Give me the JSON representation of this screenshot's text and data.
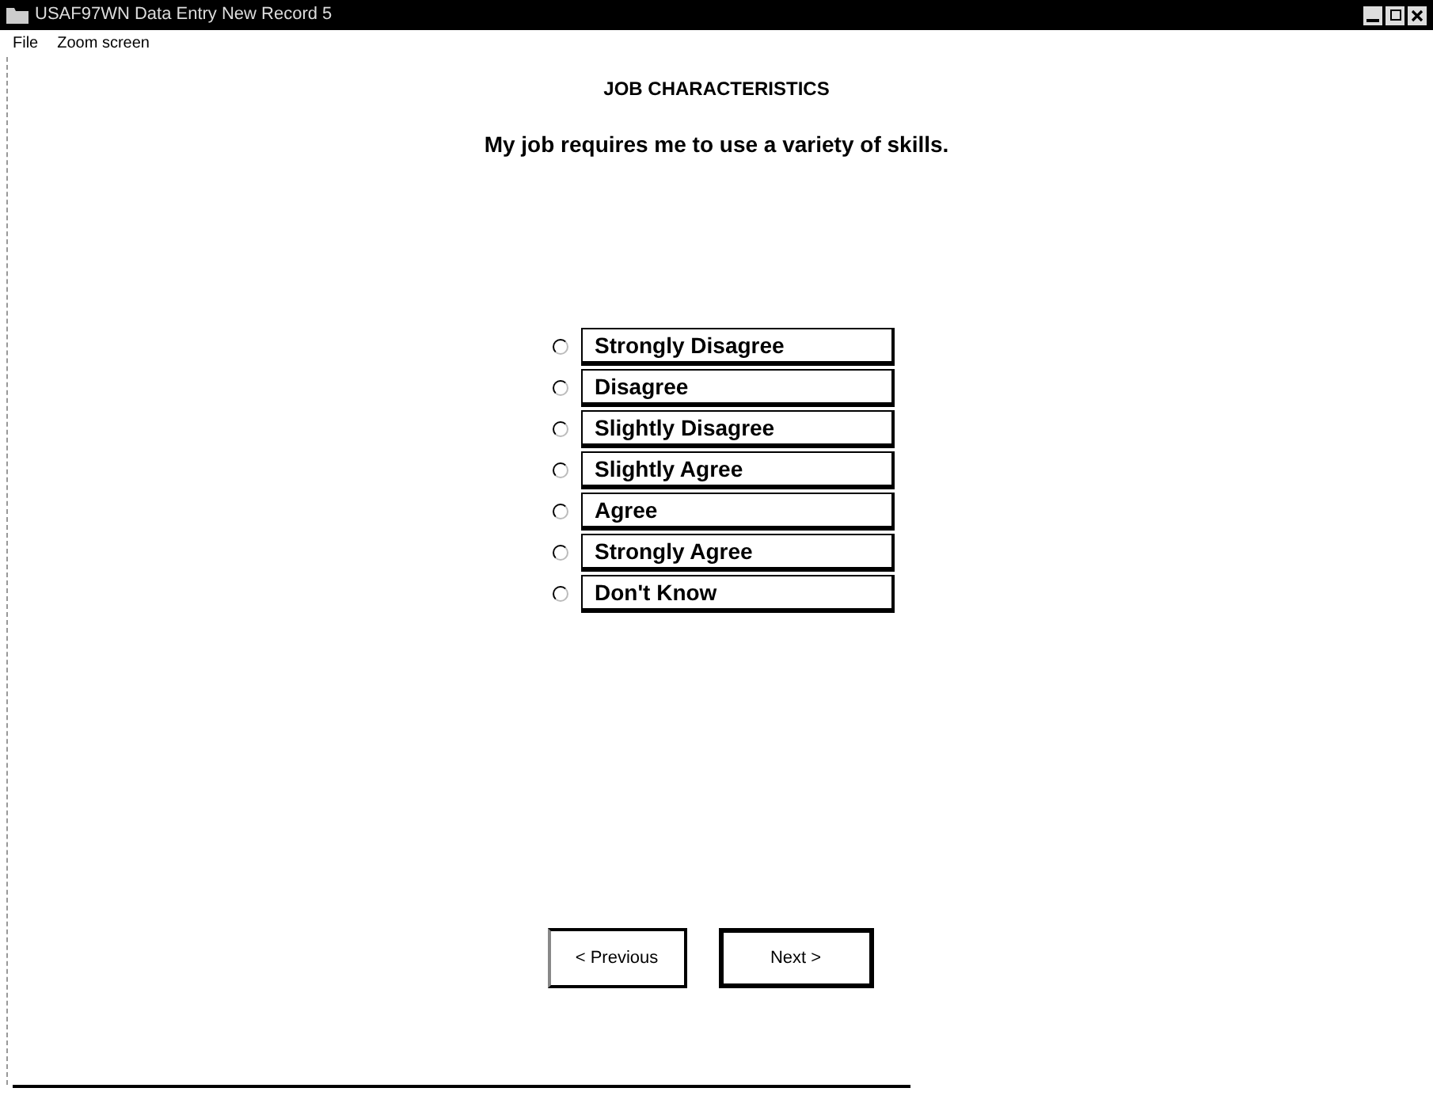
{
  "window": {
    "title": "USAF97WN Data Entry New Record 5"
  },
  "menu": [
    "File",
    "Zoom screen"
  ],
  "heading": "JOB CHARACTERISTICS",
  "question": "My job requires me to use a variety of skills.",
  "options": [
    {
      "label": "Strongly Disagree",
      "selected": false
    },
    {
      "label": "Disagree",
      "selected": false
    },
    {
      "label": "Slightly Disagree",
      "selected": false
    },
    {
      "label": "Slightly Agree",
      "selected": false
    },
    {
      "label": "Agree",
      "selected": false
    },
    {
      "label": "Strongly Agree",
      "selected": false
    },
    {
      "label": "Don't Know",
      "selected": false
    }
  ],
  "buttons": [
    {
      "label": "< Previous",
      "default": false
    },
    {
      "label": "Next >",
      "default": true
    }
  ]
}
